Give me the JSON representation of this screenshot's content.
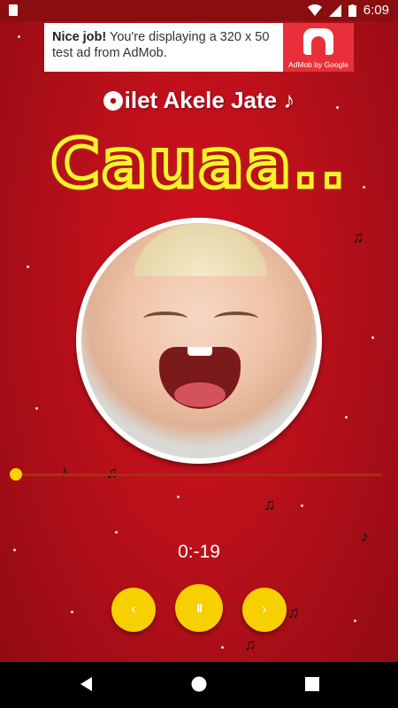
{
  "status_bar": {
    "time": "6:09"
  },
  "ad": {
    "headline": "Nice job!",
    "body": "You're displaying a 320 x 50 test ad from AdMob.",
    "brand": "AdMob by Google"
  },
  "player": {
    "title": "ilet Akele Jate",
    "big_word": "Cauaa..",
    "progress_fraction": 0.0,
    "time_label": "0:-19",
    "prev_label": "‹",
    "pause_label": "II",
    "next_label": "›"
  },
  "colors": {
    "background": "#b8101a",
    "accent_yellow": "#f6d000",
    "seek_track": "#a8300f",
    "ad_logo": "#e9303a"
  }
}
